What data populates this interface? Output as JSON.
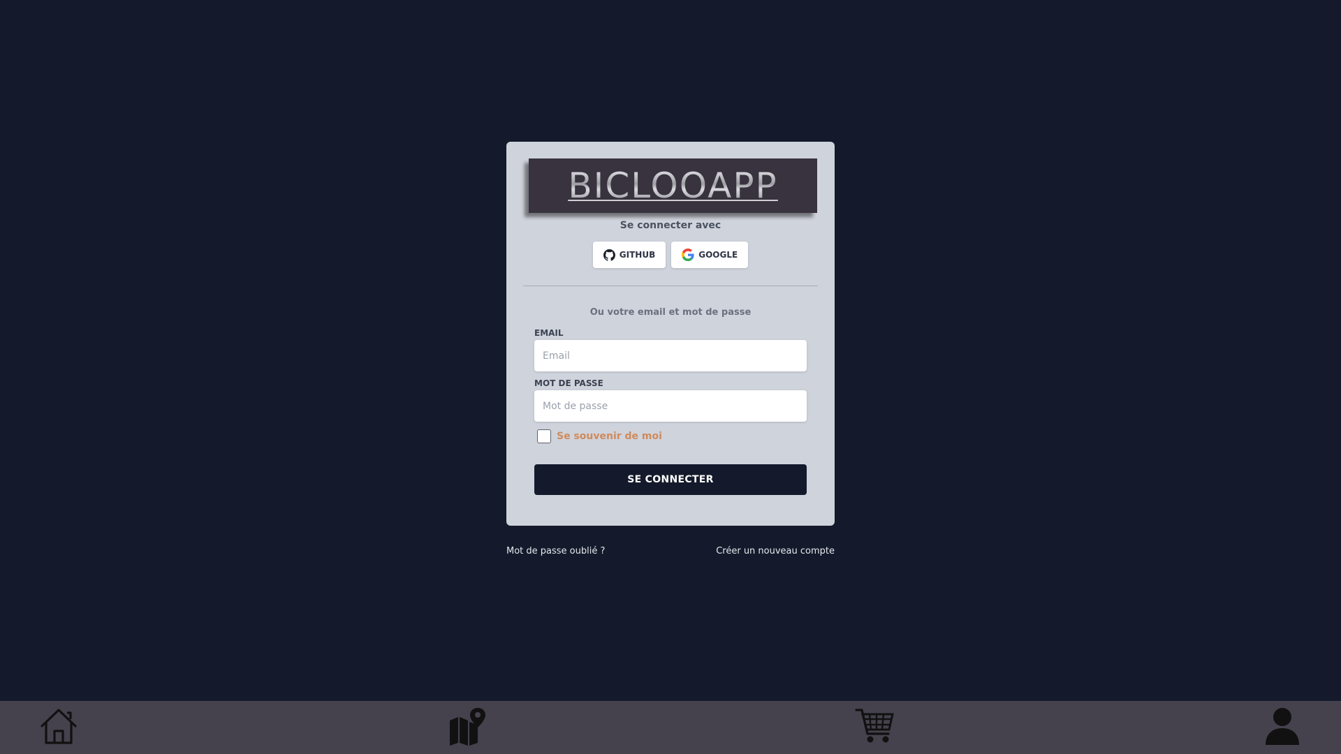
{
  "brand": {
    "name": "BICLOOAPP"
  },
  "login": {
    "connect_with": "Se connecter avec",
    "social": [
      {
        "label": "GITHUB",
        "icon": "github-icon"
      },
      {
        "label": "GOOGLE",
        "icon": "google-icon"
      }
    ],
    "alt_text": "Ou votre email et mot de passe",
    "email_label": "EMAIL",
    "email_placeholder": "Email",
    "email_value": "",
    "password_label": "MOT DE PASSE",
    "password_placeholder": "Mot de passe",
    "password_value": "",
    "remember_label": "Se souvenir de moi",
    "remember_checked": false,
    "submit_label": "SE CONNECTER"
  },
  "links": {
    "forgot_password": "Mot de passe oublié ?",
    "create_account": "Créer un nouveau compte"
  },
  "bottom_nav": {
    "items": [
      {
        "icon": "home-icon"
      },
      {
        "icon": "map-pin-icon"
      },
      {
        "icon": "cart-icon"
      },
      {
        "icon": "user-icon"
      }
    ]
  },
  "colors": {
    "background": "#141a2b",
    "card": "#cfd3dc",
    "accent": "#d08a5a",
    "nav": "#45424d"
  }
}
